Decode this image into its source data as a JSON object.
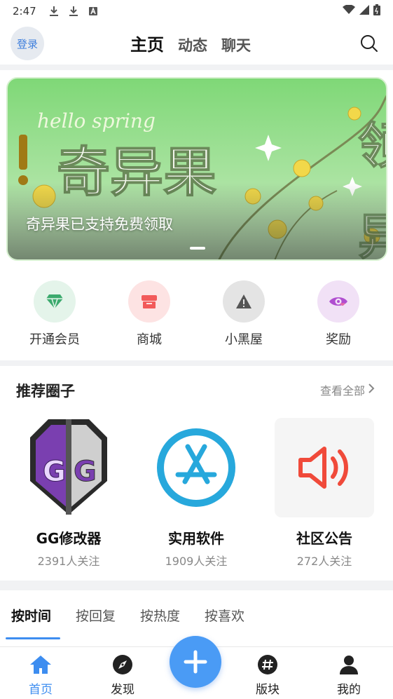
{
  "status_bar": {
    "time": "2:47"
  },
  "header": {
    "login_label": "登录",
    "tabs": [
      {
        "label": "主页",
        "active": true
      },
      {
        "label": "动态",
        "active": false
      },
      {
        "label": "聊天",
        "active": false
      }
    ]
  },
  "banner": {
    "caption": "奇异果已支持免费领取",
    "art_text_small": "hello spring",
    "art_text_big": "奇异果"
  },
  "quick_actions": [
    {
      "label": "开通会员",
      "icon": "diamond-icon",
      "color": "#3caa6e",
      "bg": "#e4f4ea"
    },
    {
      "label": "商城",
      "icon": "shop-icon",
      "color": "#f25a5a",
      "bg": "#fde3e3"
    },
    {
      "label": "小黑屋",
      "icon": "warning-icon",
      "color": "#555555",
      "bg": "#e4e4e4"
    },
    {
      "label": "奖励",
      "icon": "eye-heart-icon",
      "color": "#b04ed0",
      "bg": "#f1e1f6"
    }
  ],
  "recommended": {
    "title": "推荐圈子",
    "more_label": "查看全部",
    "cards": [
      {
        "name": "GG修改器",
        "fans": "2391人关注",
        "icon": "gg-logo-icon"
      },
      {
        "name": "实用软件",
        "fans": "1909人关注",
        "icon": "app-store-icon"
      },
      {
        "name": "社区公告",
        "fans": "272人关注",
        "icon": "speaker-icon"
      }
    ]
  },
  "sort_tabs": [
    {
      "label": "按时间",
      "active": true
    },
    {
      "label": "按回复",
      "active": false
    },
    {
      "label": "按热度",
      "active": false
    },
    {
      "label": "按喜欢",
      "active": false
    }
  ],
  "bottom_nav": [
    {
      "label": "首页",
      "icon": "home-icon",
      "active": true
    },
    {
      "label": "发现",
      "icon": "compass-icon",
      "active": false
    },
    {
      "label": "版块",
      "icon": "hashtag-icon",
      "active": false
    },
    {
      "label": "我的",
      "icon": "user-icon",
      "active": false
    }
  ],
  "colors": {
    "accent": "#3d8df0",
    "fab": "#4a9bf5"
  }
}
